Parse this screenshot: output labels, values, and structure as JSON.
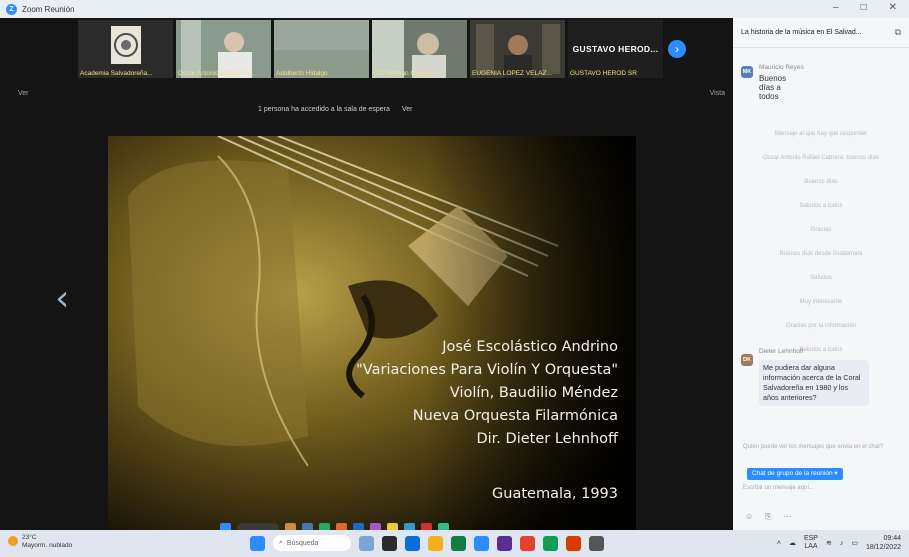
{
  "window": {
    "title": "Zoom Reunión",
    "controls": [
      "–",
      "□",
      "✕"
    ]
  },
  "participants": [
    {
      "name": "Academia Salvadoreña...",
      "kind": "seal"
    },
    {
      "name": "Oscar Antonio Rafael Ca...",
      "kind": "person"
    },
    {
      "name": "Adalberto Hidalgo",
      "kind": "blank"
    },
    {
      "name": "DC Germán Cáceres",
      "kind": "person"
    },
    {
      "name": "EUGENIA LÓPEZ VELÁZ...",
      "kind": "person"
    },
    {
      "name": "GUSTAVO HEROD...",
      "kind": "name",
      "label": "GUSTAVO HEROD SR"
    }
  ],
  "meeting": {
    "topbar_left": "Ver",
    "topbar_right": "Vista",
    "waiting_text": "1 persona ha accedido a la sala de espera",
    "waiting_action": "Ver"
  },
  "slide": {
    "lines": [
      "José Escolástico Andrino",
      "\"Variaciones Para Violín Y Orquesta\"",
      "Violín, Baudilio Méndez",
      "Nueva Orquesta Filarmónica",
      "Dir. Dieter Lehnhoff"
    ],
    "place": "Guatemala, 1993"
  },
  "chat": {
    "title": "La historia de la música en El Salvad...",
    "messages": [
      {
        "initials": "MK",
        "sender": "Mauricio Reyes",
        "text": "Buenos días a todos",
        "color": "#5a7fb8"
      },
      {
        "initials": "DK",
        "sender": "Dieter Lehnhoff",
        "text": "Me pudiera dar alguna información acerca de la Coral Salvadoreña en 1980 y los años anteriores?",
        "color": "#a07a5a"
      }
    ],
    "faint": [
      "Mensaje al que hay que responder",
      "Oscar Antonio Rafael Cabrera: buenos días",
      "Buenos días",
      "Saludos a todos",
      "Gracias",
      "Buenos días desde Guatemala",
      "Saludos",
      "Muy interesante",
      "Gracias por la información",
      "Saludos a todos",
      "Gracias"
    ],
    "note": "Quién puede ver los mensajes que envía en el chat?",
    "to_label": "Chat de grupo de la reunión ▾",
    "input_placeholder": "Escribir un mensaje aquí...",
    "tools": [
      "☺",
      "⎘",
      "⋯"
    ]
  },
  "taskbar": {
    "weather_temp": "23°C",
    "weather_desc": "Mayorm. nublado",
    "search_placeholder": "Búsqueda",
    "tray_lang": "ESP",
    "tray_region": "LAA",
    "time": "09:44",
    "date": "18/12/2022",
    "app_colors": [
      "#2d8cff",
      "#2a2a2a",
      "#0b6fd6",
      "#f2b01e",
      "#107c41",
      "#5c2d91",
      "#e0442c",
      "#0f9d58",
      "#2d8cff",
      "#d83b01",
      "#555"
    ]
  }
}
